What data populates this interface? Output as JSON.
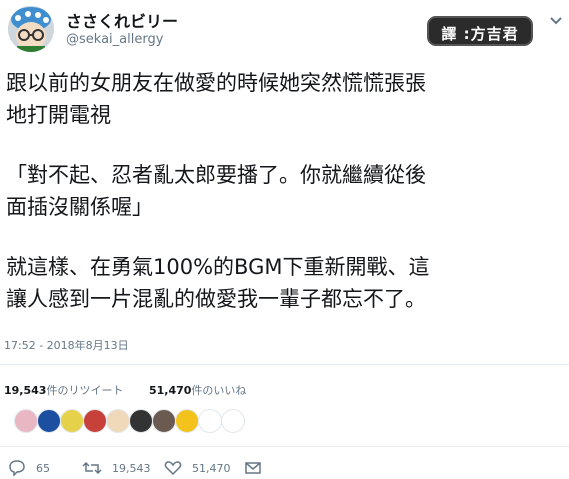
{
  "user": {
    "display_name": "ささくれビリー",
    "handle": "@sekai_allergy"
  },
  "badge": {
    "text": "譯 :方吉君"
  },
  "tweet": {
    "lines": [
      "跟以前的女朋友在做愛的時候她突然慌慌張張",
      "地打開電視",
      "「對不起、忍者亂太郎要播了。你就繼續從後",
      "面插沒關係喔」",
      "就這樣、在勇氣100%的BGM下重新開戰、這",
      "讓人感到一片混亂的做愛我一輩子都忘不了。"
    ]
  },
  "timestamp": "17:52 - 2018年8月13日",
  "stats": {
    "retweets_count": "19,543",
    "retweets_label": "件のリツイート",
    "likes_count": "51,470",
    "likes_label": "件のいいね"
  },
  "likers": [
    {
      "name": "liker-avatar-1",
      "color": "#e9b7c3"
    },
    {
      "name": "liker-avatar-2",
      "color": "#1c4fa0"
    },
    {
      "name": "liker-avatar-3",
      "color": "#e6d24a"
    },
    {
      "name": "liker-avatar-4",
      "color": "#c8403a"
    },
    {
      "name": "liker-avatar-5",
      "color": "#f0d9b8"
    },
    {
      "name": "liker-avatar-6",
      "color": "#333333"
    },
    {
      "name": "liker-avatar-7",
      "color": "#6a5a50"
    },
    {
      "name": "liker-avatar-8",
      "color": "#f3c21b"
    },
    {
      "name": "liker-avatar-9",
      "color": "#ffffff"
    },
    {
      "name": "liker-avatar-10",
      "color": "#ffffff"
    }
  ],
  "actions": {
    "reply_count": "65",
    "retweet_count": "19,543",
    "like_count": "51,470"
  },
  "icons": {
    "reply": "reply-icon",
    "retweet": "retweet-icon",
    "like": "heart-icon",
    "dm": "mail-icon",
    "caret": "chevron-down-icon"
  }
}
